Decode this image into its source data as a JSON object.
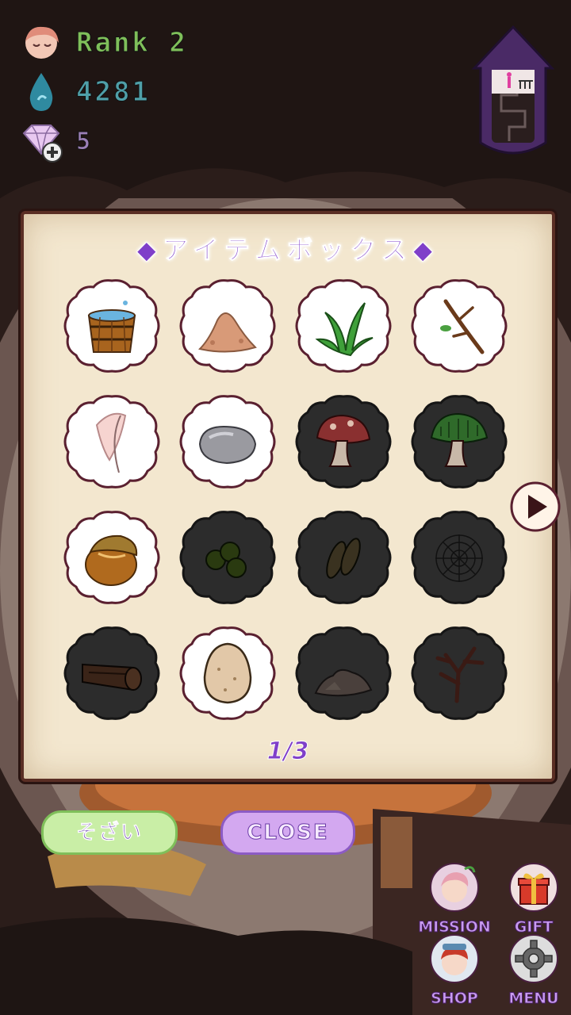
{
  "hud": {
    "rank": "Rank 2",
    "drops": "4281",
    "gems": "5"
  },
  "item_box": {
    "title": "◆アイテムボックス◆",
    "page": "1/3",
    "items": [
      {
        "name": "bucket",
        "icon": "bucket-icon",
        "owned": true
      },
      {
        "name": "sand",
        "icon": "sand-pile-icon",
        "owned": true
      },
      {
        "name": "grass",
        "icon": "grass-icon",
        "owned": true
      },
      {
        "name": "twig",
        "icon": "twig-icon",
        "owned": true
      },
      {
        "name": "feather",
        "icon": "feather-icon",
        "owned": true
      },
      {
        "name": "stone",
        "icon": "stone-icon",
        "owned": true
      },
      {
        "name": "red mushroom",
        "icon": "red-mushroom-icon",
        "owned": false
      },
      {
        "name": "green mushroom",
        "icon": "green-mushroom-icon",
        "owned": false
      },
      {
        "name": "acorn",
        "icon": "acorn-icon",
        "owned": true
      },
      {
        "name": "berries",
        "icon": "berries-icon",
        "owned": false
      },
      {
        "name": "seeds",
        "icon": "seeds-icon",
        "owned": false
      },
      {
        "name": "spider web",
        "icon": "spider-web-icon",
        "owned": false
      },
      {
        "name": "log",
        "icon": "log-icon",
        "owned": false
      },
      {
        "name": "egg",
        "icon": "egg-icon",
        "owned": true
      },
      {
        "name": "dirt",
        "icon": "dirt-icon",
        "owned": false
      },
      {
        "name": "dead branch",
        "icon": "dead-branch-icon",
        "owned": false
      }
    ]
  },
  "buttons": {
    "materials": "そざい",
    "close": "CLOSE",
    "mission": "MISSION",
    "gift": "GIFT",
    "shop": "SHOP",
    "menu": "MENU"
  },
  "colors": {
    "panel": "#f3e7cf",
    "accent_purple": "#7f3fc9",
    "owned_slot": "#ffffff",
    "locked_slot": "#2c2c2c"
  }
}
